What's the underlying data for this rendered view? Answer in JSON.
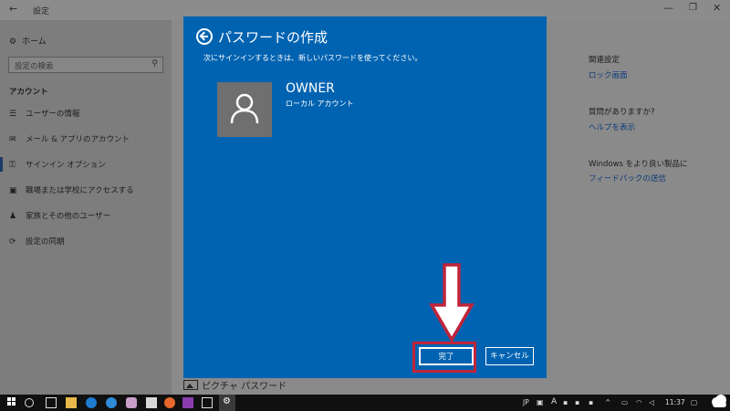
{
  "window": {
    "back_glyph": "←",
    "app_title": "設定",
    "minimize_glyph": "—",
    "maximize_glyph": "❐",
    "close_glyph": "✕"
  },
  "sidebar": {
    "home_label": "ホーム",
    "search_placeholder": "設定の検索",
    "section_title": "アカウント",
    "items": [
      {
        "label": "ユーザーの情報",
        "icon": "user-info-icon"
      },
      {
        "label": "メール & アプリのアカウント",
        "icon": "mail-icon"
      },
      {
        "label": "サインイン オプション",
        "icon": "key-icon",
        "selected": true
      },
      {
        "label": "職場または学校にアクセスする",
        "icon": "briefcase-icon"
      },
      {
        "label": "家族とその他のユーザー",
        "icon": "family-icon"
      },
      {
        "label": "設定の同期",
        "icon": "sync-icon"
      }
    ]
  },
  "related": {
    "heading": "関連設定",
    "lock_screen_link": "ロック画面",
    "question_heading": "質問がありますか?",
    "help_link": "ヘルプを表示",
    "improve_heading": "Windows をより良い製品に",
    "feedback_link": "フィードバックの送信"
  },
  "picture_password_label": "ピクチャ パスワード",
  "dialog": {
    "title": "パスワードの作成",
    "description": "次にサインインするときは、新しいパスワードを使ってください。",
    "account_name": "OWNER",
    "account_type": "ローカル アカウント",
    "finish_button": "完了",
    "cancel_button": "キャンセル",
    "background_color": "#0063b1"
  },
  "annotation": {
    "highlight_color": "#c0243a",
    "arrow_color": "#ffffff"
  },
  "taskbar": {
    "input_indicator": "JP",
    "ime_mode": "A",
    "clock": "11:37"
  }
}
